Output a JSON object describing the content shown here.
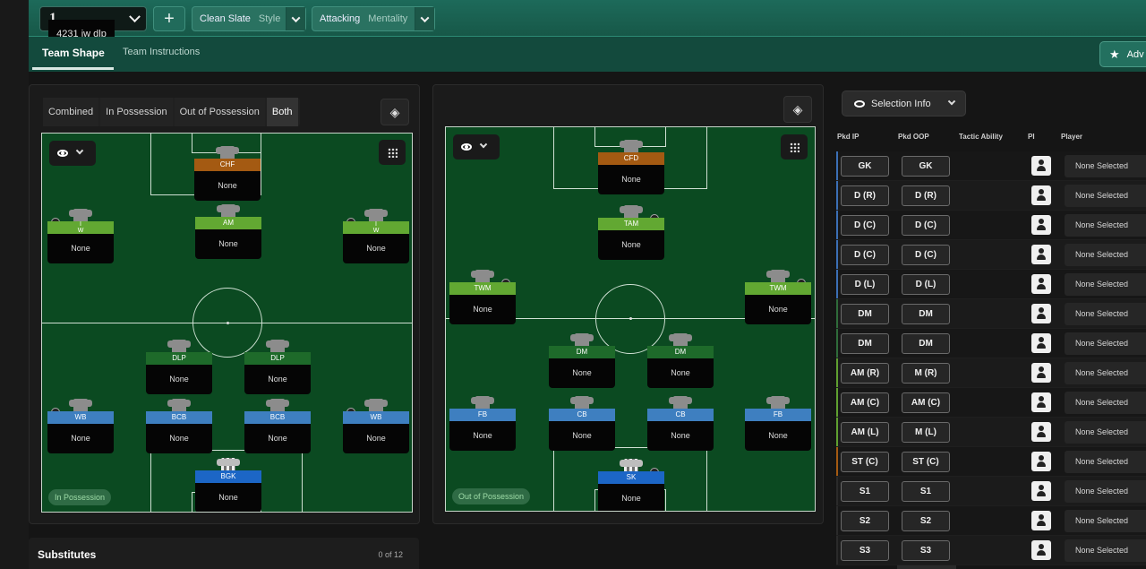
{
  "header": {
    "tactic_number": "1",
    "tactic_name": "4231 iw dlp",
    "add_label": "+",
    "style_value": "Clean Slate",
    "style_key": "Style",
    "mentality_value": "Attacking",
    "mentality_key": "Mentality",
    "advanced_label": "Adv"
  },
  "tabs": {
    "team_shape": "Team Shape",
    "team_instructions": "Team Instructions"
  },
  "modes": [
    "Combined",
    "In Possession",
    "Out of Possession",
    "Both"
  ],
  "pitch_ip": {
    "label": "In Possession",
    "players": [
      {
        "role": "CHF",
        "name": "None",
        "color": "orange"
      },
      {
        "role": "I W",
        "name": "None",
        "color": "lime"
      },
      {
        "role": "AM",
        "name": "None",
        "color": "lime"
      },
      {
        "role": "I W",
        "name": "None",
        "color": "lime"
      },
      {
        "role": "DLP",
        "name": "None",
        "color": "dg"
      },
      {
        "role": "DLP",
        "name": "None",
        "color": "dg"
      },
      {
        "role": "WB",
        "name": "None",
        "color": "blue"
      },
      {
        "role": "BCB",
        "name": "None",
        "color": "blue"
      },
      {
        "role": "BCB",
        "name": "None",
        "color": "blue"
      },
      {
        "role": "WB",
        "name": "None",
        "color": "blue"
      },
      {
        "role": "BGK",
        "name": "None",
        "color": "sk"
      }
    ]
  },
  "pitch_oop": {
    "label": "Out of Possession",
    "players": [
      {
        "role": "CFD",
        "name": "None",
        "color": "orange"
      },
      {
        "role": "TAM",
        "name": "None",
        "color": "lime"
      },
      {
        "role": "TWM",
        "name": "None",
        "color": "lime"
      },
      {
        "role": "TWM",
        "name": "None",
        "color": "lime"
      },
      {
        "role": "DM",
        "name": "None",
        "color": "dg"
      },
      {
        "role": "DM",
        "name": "None",
        "color": "dg"
      },
      {
        "role": "FB",
        "name": "None",
        "color": "blue"
      },
      {
        "role": "CB",
        "name": "None",
        "color": "blue"
      },
      {
        "role": "CB",
        "name": "None",
        "color": "blue"
      },
      {
        "role": "FB",
        "name": "None",
        "color": "blue"
      },
      {
        "role": "SK",
        "name": "None",
        "color": "sk"
      }
    ]
  },
  "substitutes": {
    "title": "Substitutes",
    "count": "0 of 12"
  },
  "selection": {
    "label": "Selection Info",
    "headers": {
      "ip": "Pkd IP",
      "oop": "Pkd OOP",
      "ability": "Tactic Ability",
      "pi": "PI",
      "player": "Player"
    },
    "rows": [
      {
        "ip": "GK",
        "oop": "GK",
        "player": "None Selected",
        "color": "#3b6fb5"
      },
      {
        "ip": "D (R)",
        "oop": "D (R)",
        "player": "None Selected",
        "color": "#3b6fb5"
      },
      {
        "ip": "D (C)",
        "oop": "D (C)",
        "player": "None Selected",
        "color": "#3b6fb5"
      },
      {
        "ip": "D (C)",
        "oop": "D (C)",
        "player": "None Selected",
        "color": "#3b6fb5"
      },
      {
        "ip": "D (L)",
        "oop": "D (L)",
        "player": "None Selected",
        "color": "#3b6fb5"
      },
      {
        "ip": "DM",
        "oop": "DM",
        "player": "None Selected",
        "color": "#2f6b3a"
      },
      {
        "ip": "DM",
        "oop": "DM",
        "player": "None Selected",
        "color": "#2f6b3a"
      },
      {
        "ip": "AM (R)",
        "oop": "M (R)",
        "player": "None Selected",
        "color": "#5fa030"
      },
      {
        "ip": "AM (C)",
        "oop": "AM (C)",
        "player": "None Selected",
        "color": "#5fa030"
      },
      {
        "ip": "AM (L)",
        "oop": "M (L)",
        "player": "None Selected",
        "color": "#5fa030"
      },
      {
        "ip": "ST (C)",
        "oop": "ST (C)",
        "player": "None Selected",
        "color": "#a45a12"
      },
      {
        "ip": "S1",
        "oop": "S1",
        "player": "None Selected",
        "color": "#2a2a2a"
      },
      {
        "ip": "S2",
        "oop": "S2",
        "player": "None Selected",
        "color": "#2a2a2a"
      },
      {
        "ip": "S3",
        "oop": "S3",
        "player": "None Selected",
        "color": "#2a2a2a"
      }
    ]
  }
}
